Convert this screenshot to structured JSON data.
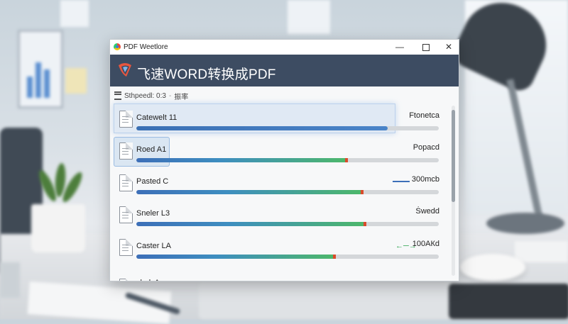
{
  "window": {
    "title": "PDF Weetlore",
    "header_title": "飞速WORD转换成PDF"
  },
  "toolbar": {
    "label": "Sthpeedl: 0:3",
    "separator": "-",
    "secondary": "振率"
  },
  "files": [
    {
      "name": "Catewelt 11",
      "status": "Ftonetca",
      "progress": 0.83,
      "style": "blue",
      "tip": false,
      "selected": true
    },
    {
      "name": "Roed A1",
      "status": "Popacd",
      "progress": 0.7,
      "style": "grad",
      "tip": true,
      "icon_selected": true
    },
    {
      "name": "Pasted C",
      "status": "300mcb",
      "progress": 0.75,
      "style": "grad",
      "tip": true,
      "size_indicator": true
    },
    {
      "name": "Sneler L3",
      "status": "Ṡwedd",
      "progress": 0.76,
      "style": "grad",
      "tip": true
    },
    {
      "name": "Caster LA",
      "status": "100АКd",
      "progress": 0.66,
      "style": "grad",
      "tip": true,
      "check": "←─→"
    },
    {
      "name": "slark A",
      "status": ""
    }
  ],
  "colors": {
    "header_bg": "#3d4c62",
    "progress_blue": "#3b70b4",
    "progress_green": "#4db86a",
    "progress_tip": "#d94b2b"
  }
}
